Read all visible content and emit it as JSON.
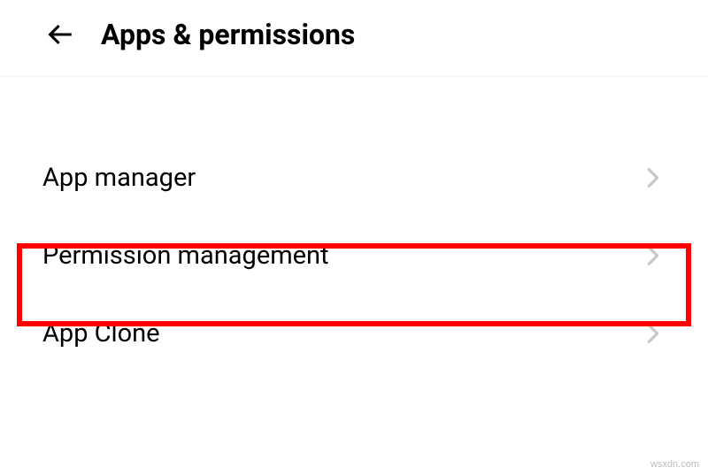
{
  "header": {
    "title": "Apps & permissions"
  },
  "items": [
    {
      "label": "App manager"
    },
    {
      "label": "Permission management"
    },
    {
      "label": "App Clone"
    }
  ],
  "watermark": "wsxdn.com"
}
